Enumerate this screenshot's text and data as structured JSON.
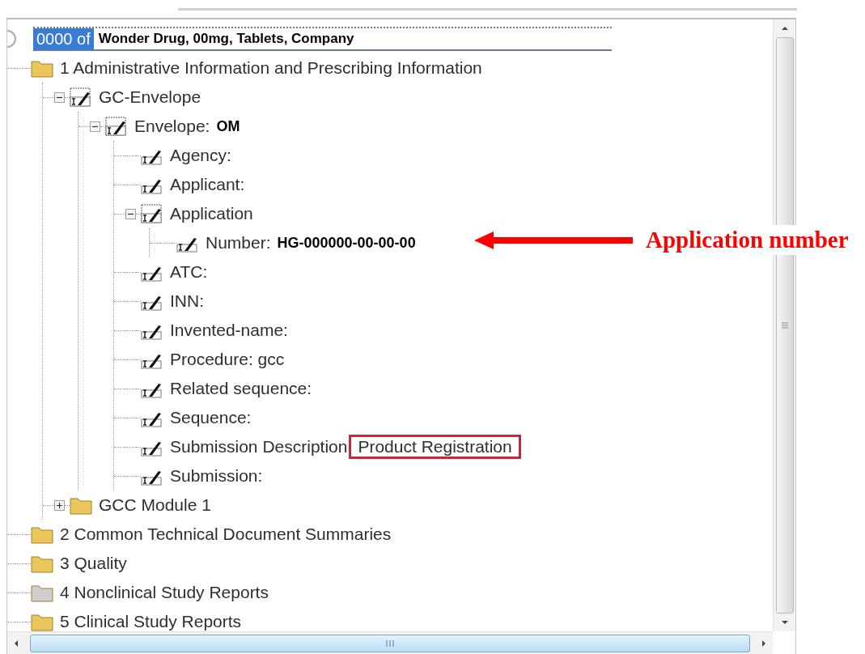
{
  "root": {
    "selected_text": "0000 of",
    "title": "Wonder Drug, 00mg, Tablets, Company"
  },
  "tree": [
    {
      "kind": "folder",
      "label": "1 Administrative Information and Prescribing Information",
      "color": "#eac55a",
      "children": [
        {
          "kind": "element",
          "label": "GC-Envelope",
          "expanded": true,
          "children": [
            {
              "kind": "element",
              "label": "Envelope:",
              "value": "OM",
              "highlighted": false,
              "expanded": true,
              "children": [
                {
                  "kind": "attribute",
                  "label": "Agency:"
                },
                {
                  "kind": "attribute",
                  "label": "Applicant:"
                },
                {
                  "kind": "element",
                  "label": "Application",
                  "expanded": true,
                  "children": [
                    {
                      "kind": "attribute",
                      "label": "Number:",
                      "value": "HG-000000-00-00-00",
                      "highlighted": false
                    }
                  ]
                },
                {
                  "kind": "attribute",
                  "label": "ATC:"
                },
                {
                  "kind": "attribute",
                  "label": "INN:"
                },
                {
                  "kind": "attribute",
                  "label": "Invented-name:"
                },
                {
                  "kind": "attribute",
                  "label": "Procedure: gcc"
                },
                {
                  "kind": "attribute",
                  "label": "Related sequence:"
                },
                {
                  "kind": "attribute",
                  "label": "Sequence:"
                },
                {
                  "kind": "attribute",
                  "label": "Submission Description",
                  "value": "Product Registration",
                  "highlighted": true
                },
                {
                  "kind": "attribute",
                  "label": "Submission:"
                }
              ]
            }
          ]
        },
        {
          "kind": "folder",
          "label": "GCC Module 1",
          "color": "#eac55a",
          "expanded": false
        }
      ]
    },
    {
      "kind": "folder",
      "label": "2 Common Technical Document Summaries",
      "color": "#eac55a"
    },
    {
      "kind": "folder",
      "label": "3 Quality",
      "color": "#eac55a"
    },
    {
      "kind": "folder",
      "label": "4 Nonclinical Study Reports",
      "color": "#cfcfcf"
    },
    {
      "kind": "folder",
      "label": "5 Clinical Study Reports",
      "color": "#eac55a"
    }
  ],
  "annotation": {
    "label": "Application number"
  }
}
